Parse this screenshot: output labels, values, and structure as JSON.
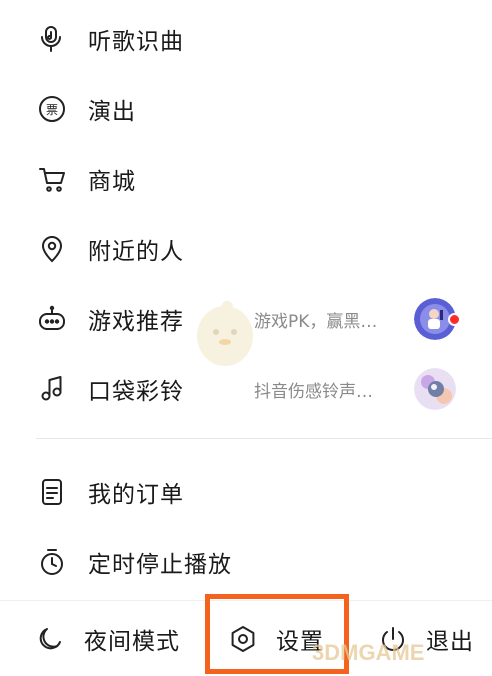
{
  "menu": {
    "items": [
      {
        "label": "听歌识曲",
        "icon": "microphone-music-icon"
      },
      {
        "label": "演出",
        "icon": "ticket-icon"
      },
      {
        "label": "商城",
        "icon": "cart-icon"
      },
      {
        "label": "附近的人",
        "icon": "location-pin-icon"
      },
      {
        "label": "游戏推荐",
        "icon": "gamepad-icon",
        "sub": "游戏PK，赢黑…",
        "has_avatar": true,
        "has_dot": true
      },
      {
        "label": "口袋彩铃",
        "icon": "music-note-icon",
        "sub": "抖音伤感铃声…",
        "has_avatar": true
      },
      {
        "label": "我的订单",
        "icon": "order-document-icon"
      },
      {
        "label": "定时停止播放",
        "icon": "timer-icon"
      }
    ]
  },
  "bottom_bar": {
    "night_mode": "夜间模式",
    "settings": "设置",
    "logout": "退出"
  },
  "watermark": "3DMGAME",
  "colors": {
    "highlight": "#f5621e",
    "badge": "#ff2b2b",
    "text": "#1a1a1a",
    "subtext": "#8a8a8a"
  }
}
